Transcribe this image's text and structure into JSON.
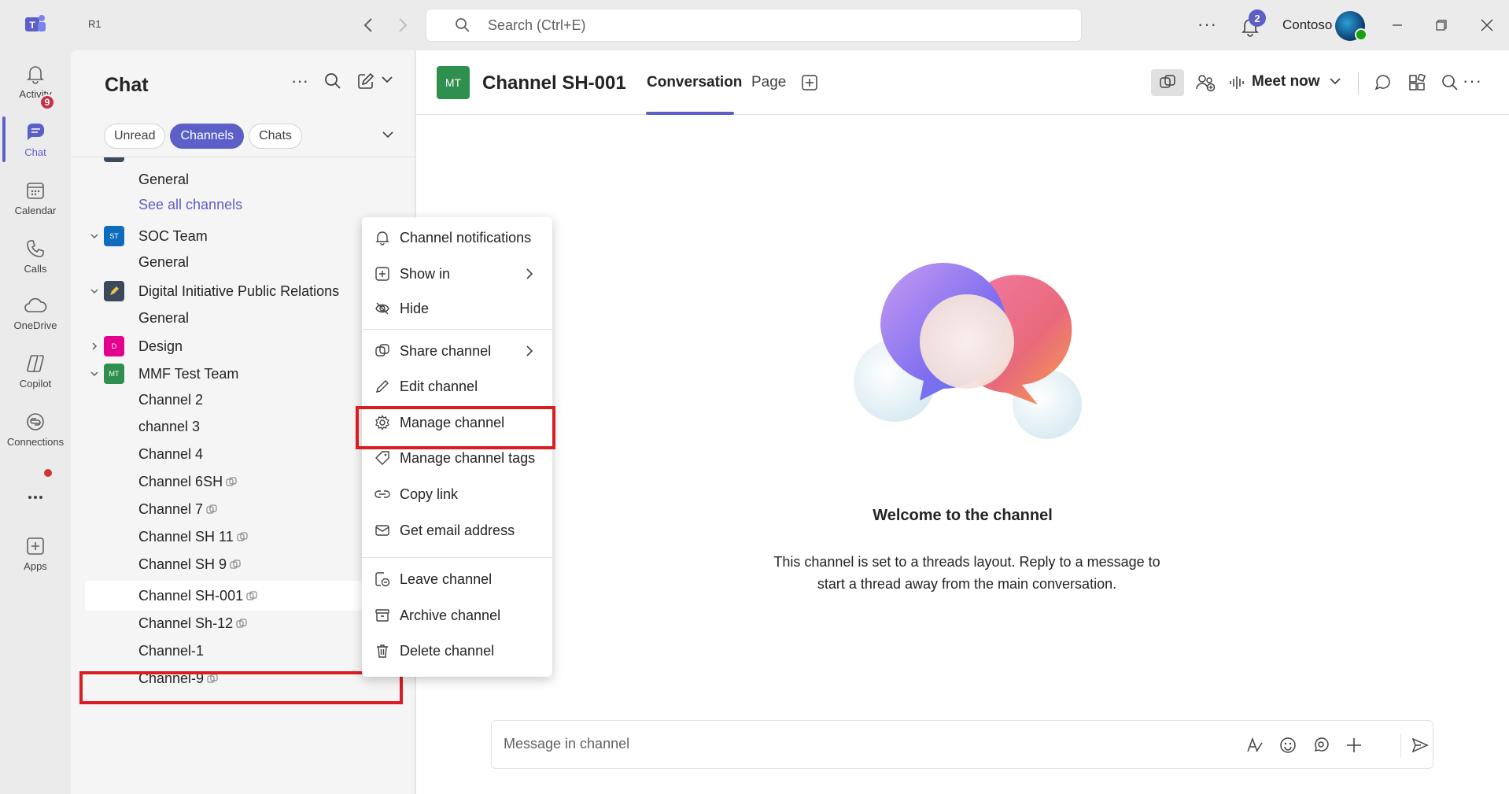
{
  "titlebar": {
    "app_name": "R1",
    "search_placeholder": "Search (Ctrl+E)",
    "notifications_count": "2",
    "org_name": "Contoso"
  },
  "rail": {
    "items": [
      {
        "label": "Activity",
        "icon": "bell-icon"
      },
      {
        "label": "Chat",
        "icon": "chat-icon",
        "badge": "9"
      },
      {
        "label": "Calendar",
        "icon": "calendar-icon"
      },
      {
        "label": "Calls",
        "icon": "phone-icon"
      },
      {
        "label": "OneDrive",
        "icon": "cloud-icon"
      },
      {
        "label": "Copilot",
        "icon": "copilot-icon"
      },
      {
        "label": "Connections",
        "icon": "connections-icon"
      },
      {
        "label": "Apps",
        "icon": "add-apps-icon"
      }
    ]
  },
  "chat": {
    "title": "Chat",
    "filters": [
      "Unread",
      "Channels",
      "Chats"
    ],
    "active_filter": "Channels",
    "list": [
      {
        "type": "channel",
        "label": "General"
      },
      {
        "type": "link",
        "label": "See all channels"
      },
      {
        "type": "team",
        "label": "SOC Team",
        "avatar": "ST",
        "color": "#0f6cbd",
        "expanded": true
      },
      {
        "type": "channel",
        "label": "General"
      },
      {
        "type": "team",
        "label": "Digital Initiative Public Relations",
        "avatar": "",
        "color": "#3b4a5a",
        "expanded": true
      },
      {
        "type": "channel",
        "label": "General"
      },
      {
        "type": "team",
        "label": "Design",
        "avatar": "D",
        "color": "#e3008c",
        "expanded": false
      },
      {
        "type": "team",
        "label": "MMF Test Team",
        "avatar": "MT",
        "color": "#2f8f4e",
        "expanded": true
      },
      {
        "type": "channel",
        "label": "Channel 2"
      },
      {
        "type": "channel",
        "label": "channel 3"
      },
      {
        "type": "channel",
        "label": "Channel 4"
      },
      {
        "type": "channel",
        "label": "Channel 6SH",
        "shared": true
      },
      {
        "type": "channel",
        "label": "Channel 7",
        "shared": true
      },
      {
        "type": "channel",
        "label": "Channel SH 11",
        "shared": true
      },
      {
        "type": "channel",
        "label": "Channel SH 9",
        "shared": true
      },
      {
        "type": "channel",
        "label": "Channel SH-001",
        "shared": true,
        "selected": true
      },
      {
        "type": "channel",
        "label": "Channel Sh-12",
        "shared": true
      },
      {
        "type": "channel",
        "label": "Channel-1"
      },
      {
        "type": "channel",
        "label": "Channel-9",
        "shared": true
      }
    ]
  },
  "context_menu": {
    "items": [
      {
        "label": "Channel notifications",
        "icon": "bell-icon"
      },
      {
        "label": "Show in",
        "icon": "plus-square-icon",
        "submenu": true
      },
      {
        "label": "Hide",
        "icon": "eye-off-icon"
      },
      {
        "label": "Share channel",
        "icon": "share-channel-icon",
        "submenu": true
      },
      {
        "label": "Edit channel",
        "icon": "pencil-icon"
      },
      {
        "label": "Manage channel",
        "icon": "gear-icon"
      },
      {
        "label": "Manage channel tags",
        "icon": "tag-icon"
      },
      {
        "label": "Copy link",
        "icon": "link-icon"
      },
      {
        "label": "Get email address",
        "icon": "mail-icon"
      },
      {
        "label": "Leave channel",
        "icon": "leave-icon"
      },
      {
        "label": "Archive channel",
        "icon": "archive-icon"
      },
      {
        "label": "Delete channel",
        "icon": "trash-icon"
      }
    ]
  },
  "main": {
    "channel_avatar": "MT",
    "channel_title": "Channel SH-001",
    "tabs": [
      "Conversation",
      "Page"
    ],
    "active_tab": "Conversation",
    "meet_now": "Meet now",
    "welcome_title": "Welcome to the channel",
    "welcome_line1": "This channel is set to a threads layout. Reply to a message to",
    "welcome_line2": "start a thread away from the main conversation.",
    "composer_placeholder": "Message in channel"
  },
  "colors": {
    "brand": "#5b5fc7",
    "highlight": "#d91d20",
    "badge_red": "#c4314b"
  }
}
